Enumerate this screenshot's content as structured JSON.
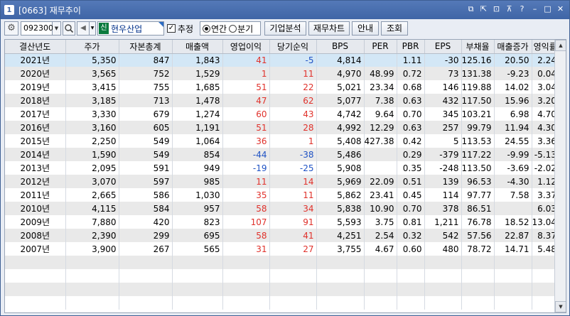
{
  "window": {
    "number": "1",
    "title": "[0663] 재무추이"
  },
  "toolbar": {
    "code_value": "092300",
    "stock_badge": "신",
    "stock_name": "현우산업",
    "checkbox_label": "추정",
    "checkbox_checked": true,
    "radio_options": [
      "연간",
      "분기"
    ],
    "radio_selected": "연간",
    "buttons": [
      "기업분석",
      "재무차트",
      "안내",
      "조회"
    ]
  },
  "table": {
    "columns": [
      "결산년도",
      "주가",
      "자본총계",
      "매출액",
      "영업이익",
      "당기순익",
      "BPS",
      "PER",
      "PBR",
      "EPS",
      "부채율",
      "매출증가",
      "영익률"
    ],
    "rows": [
      [
        "2021년",
        "5,350",
        "847",
        "1,843",
        "41",
        "-5",
        "4,814",
        "",
        "1.11",
        "-30",
        "125.16",
        "20.50",
        "2.24"
      ],
      [
        "2020년",
        "3,565",
        "752",
        "1,529",
        "1",
        "11",
        "4,970",
        "48.99",
        "0.72",
        "73",
        "131.38",
        "-9.23",
        "0.04"
      ],
      [
        "2019년",
        "3,415",
        "755",
        "1,685",
        "51",
        "22",
        "5,021",
        "23.34",
        "0.68",
        "146",
        "119.88",
        "14.02",
        "3.04"
      ],
      [
        "2018년",
        "3,185",
        "713",
        "1,478",
        "47",
        "62",
        "5,077",
        "7.38",
        "0.63",
        "432",
        "117.50",
        "15.96",
        "3.20"
      ],
      [
        "2017년",
        "3,330",
        "679",
        "1,274",
        "60",
        "43",
        "4,742",
        "9.64",
        "0.70",
        "345",
        "103.21",
        "6.98",
        "4.70"
      ],
      [
        "2016년",
        "3,160",
        "605",
        "1,191",
        "51",
        "28",
        "4,992",
        "12.29",
        "0.63",
        "257",
        "99.79",
        "11.94",
        "4.30"
      ],
      [
        "2015년",
        "2,250",
        "549",
        "1,064",
        "36",
        "1",
        "5,408",
        "427.38",
        "0.42",
        "5",
        "113.53",
        "24.55",
        "3.36"
      ],
      [
        "2014년",
        "1,590",
        "549",
        "854",
        "-44",
        "-38",
        "5,486",
        "",
        "0.29",
        "-379",
        "117.22",
        "-9.99",
        "-5.13"
      ],
      [
        "2013년",
        "2,095",
        "591",
        "949",
        "-19",
        "-25",
        "5,908",
        "",
        "0.35",
        "-248",
        "113.50",
        "-3.69",
        "-2.02"
      ],
      [
        "2012년",
        "3,070",
        "597",
        "985",
        "11",
        "14",
        "5,969",
        "22.09",
        "0.51",
        "139",
        "96.53",
        "-4.30",
        "1.12"
      ],
      [
        "2011년",
        "2,665",
        "586",
        "1,030",
        "35",
        "11",
        "5,862",
        "23.41",
        "0.45",
        "114",
        "97.77",
        "7.58",
        "3.37"
      ],
      [
        "2010년",
        "4,115",
        "584",
        "957",
        "58",
        "34",
        "5,838",
        "10.90",
        "0.70",
        "378",
        "86.51",
        "",
        "6.03"
      ],
      [
        "2009년",
        "7,880",
        "420",
        "823",
        "107",
        "91",
        "5,593",
        "3.75",
        "0.81",
        "1,211",
        "76.78",
        "18.52",
        "13.04"
      ],
      [
        "2008년",
        "2,390",
        "299",
        "695",
        "58",
        "41",
        "4,251",
        "2.54",
        "0.32",
        "542",
        "57.56",
        "22.87",
        "8.37"
      ],
      [
        "2007년",
        "3,900",
        "267",
        "565",
        "31",
        "27",
        "3,755",
        "4.67",
        "0.60",
        "480",
        "78.72",
        "14.71",
        "5.48"
      ]
    ],
    "selected_row": 0
  },
  "colors": {
    "title_bar": "#4a6fb0",
    "positive": "#e0312b",
    "negative": "#1f52c4",
    "selected_row": "#d3e7f6",
    "stock_badge": "#0a7a3e"
  }
}
